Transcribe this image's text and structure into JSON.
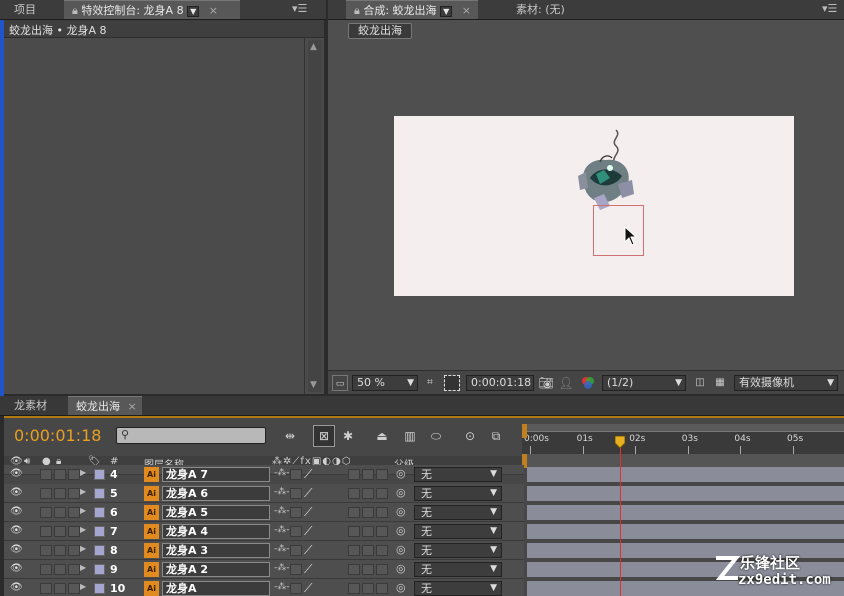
{
  "left_panel": {
    "tab_project": "项目",
    "tab_effects": "特效控制台: 龙身A 8",
    "breadcrumb": "蛟龙出海 • 龙身A 8"
  },
  "comp_panel": {
    "tab_comp": "合成: 蛟龙出海",
    "tab_footage": "素材: (无)",
    "comp_button": "蛟龙出海",
    "zoom": "50 %",
    "timecode": "0:00:01:18",
    "resolution": "(1/2)",
    "camera": "有效摄像机"
  },
  "timeline": {
    "tab_dragon": "龙素材",
    "tab_comp": "蛟龙出海",
    "timecode": "0:00:01:18",
    "search_placeholder": "",
    "col_number": "#",
    "col_layer_name": "图层名称",
    "col_parent": "父级",
    "ruler_labels": [
      "0:00s",
      "01s",
      "02s",
      "03s",
      "04s",
      "05s"
    ],
    "current_time_seconds": 1.72,
    "layers": [
      {
        "num": "4",
        "name": "龙身A 7",
        "mode": "无"
      },
      {
        "num": "5",
        "name": "龙身A 6",
        "mode": "无"
      },
      {
        "num": "6",
        "name": "龙身A 5",
        "mode": "无"
      },
      {
        "num": "7",
        "name": "龙身A 4",
        "mode": "无"
      },
      {
        "num": "8",
        "name": "龙身A 3",
        "mode": "无"
      },
      {
        "num": "9",
        "name": "龙身A 2",
        "mode": "无"
      },
      {
        "num": "10",
        "name": "龙身A",
        "mode": "无"
      }
    ]
  },
  "watermark": {
    "text": "zx9edit.com",
    "brand": "乐锋社区"
  },
  "colors": {
    "accent_timecode": "#e8a020",
    "playhead": "#e03030",
    "layer_bar": "#8a8d99"
  }
}
